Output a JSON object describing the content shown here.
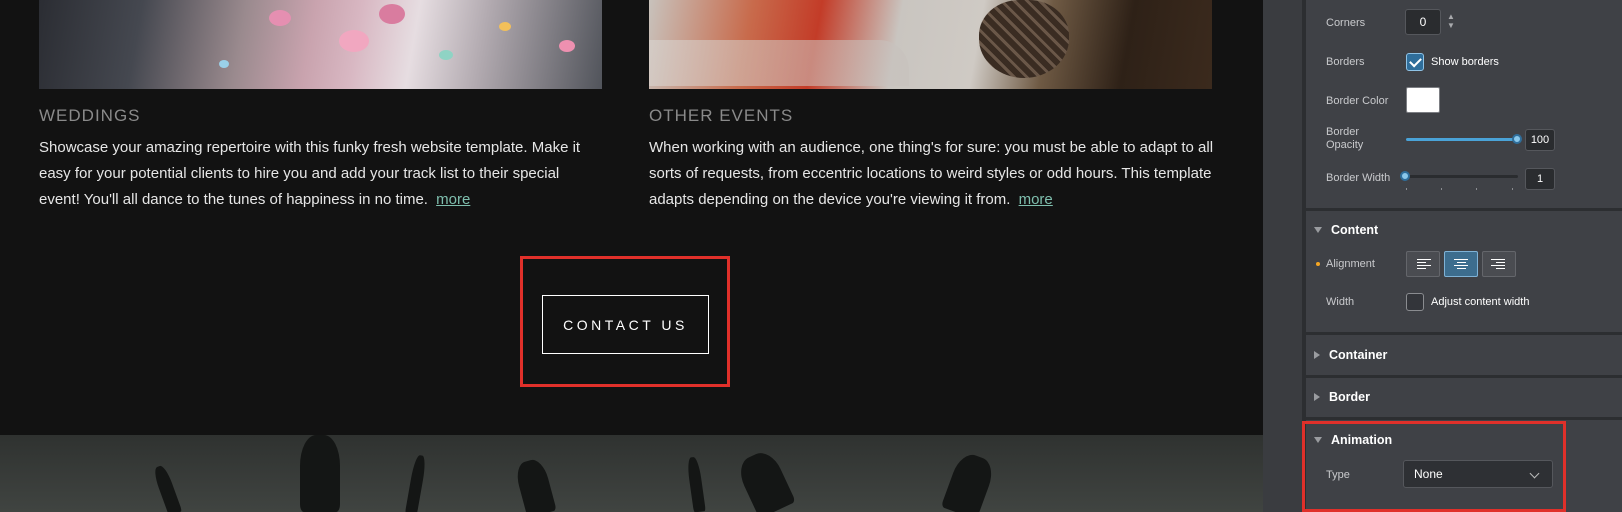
{
  "canvas": {
    "weddings": {
      "title": "WEDDINGS",
      "text": "Showcase your amazing repertoire with this funky fresh website template. Make it easy for your potential clients to hire you and add your track list to their special event! You'll all dance to the tunes of happiness in no time.",
      "more": "more"
    },
    "other_events": {
      "title": "OTHER EVENTS",
      "text": "When working with an audience, one thing's for sure: you must be able to adapt to all sorts of requests, from eccentric locations to weird styles or odd hours. This template adapts depending on the device you're viewing it from.",
      "more": "more"
    },
    "contact_button": "CONTACT US"
  },
  "panel": {
    "corners": {
      "label": "Corners",
      "value": "0"
    },
    "borders": {
      "label": "Borders",
      "checkbox_label": "Show borders",
      "checked": true
    },
    "border_color": {
      "label": "Border Color",
      "color": "#ffffff"
    },
    "border_opacity": {
      "label": "Border Opacity",
      "value": "100",
      "fraction": 1.0
    },
    "border_width": {
      "label": "Border Width",
      "value": "1",
      "fraction": 0.0
    },
    "content_section": {
      "label": "Content",
      "alignment_label": "Alignment",
      "alignment_options": [
        "align-left-icon",
        "align-center-icon",
        "align-right-icon"
      ],
      "selected_alignment": "center",
      "width_label": "Width",
      "width_checkbox_label": "Adjust content width",
      "width_checked": false
    },
    "container_section": {
      "label": "Container"
    },
    "border_section": {
      "label": "Border"
    },
    "animation_section": {
      "label": "Animation",
      "type_label": "Type",
      "type_value": "None"
    }
  },
  "colors": {
    "highlight": "#e0302a",
    "accent": "#4aa3d8",
    "link": "#7fbfae"
  }
}
